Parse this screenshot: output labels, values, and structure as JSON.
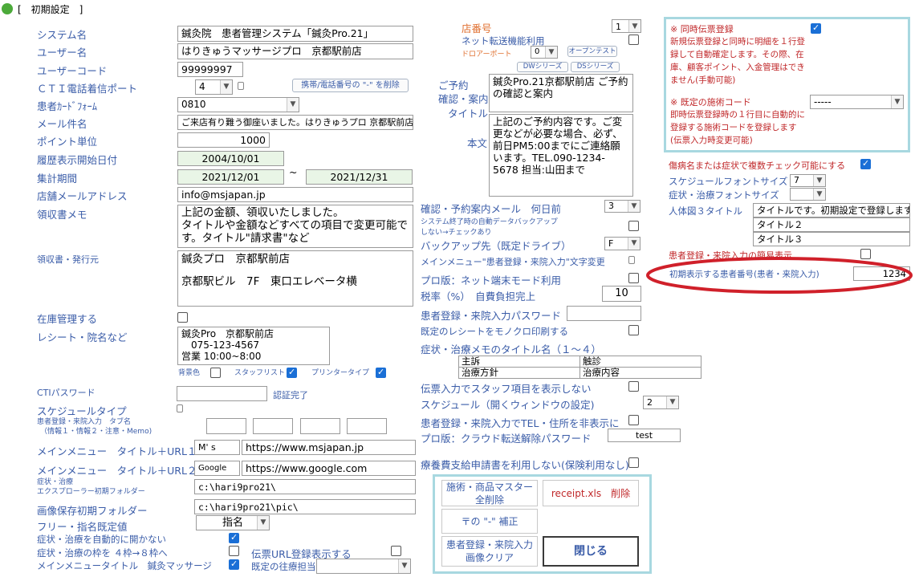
{
  "window": {
    "title": "[　初期設定　]",
    "bracket": "["
  },
  "left": {
    "system_name": {
      "label": "システム名",
      "value": "鍼灸院　患者管理システム「鍼灸Pro.21」"
    },
    "user_name": {
      "label": "ユーザー名",
      "value": "はりきゅうマッサージプロ　京都駅前店"
    },
    "user_code": {
      "label": "ユーザーコード",
      "value": "99999997"
    },
    "cti_port": {
      "label": "ＣＴＩ電話着信ポート",
      "value": "4",
      "btn": "携帯/電話番号の \"-\" を削除"
    },
    "card_form": {
      "label": "患者ｶｰﾄﾞﾌｫｰﾑ",
      "value": "0810"
    },
    "mail_subject": {
      "label": "メール件名",
      "value": "ご来店有り難う御座いました。はりきゅうプロ 京都駅前店"
    },
    "point_unit": {
      "label": "ポイント単位",
      "value": "1000"
    },
    "history_start": {
      "label": "履歴表示開始日付",
      "value": "2004/10/01"
    },
    "period": {
      "label": "集計期間",
      "from": "2021/12/01",
      "sep": "~",
      "to": "2021/12/31"
    },
    "shop_mail": {
      "label": "店舗メールアドレス",
      "value": "info@msjapan.jp"
    },
    "receipt_memo": {
      "label": "領収書メモ",
      "value": "上記の金額、領収いたしました。\nタイトルや金額などすべての項目で変更可能です。タイトル\"請求書\"など"
    },
    "receipt_issuer": {
      "label": "領収書・発行元",
      "line1": "鍼灸プロ　京都駅前店",
      "line2": "京都駅ビル　7F　東口エレベータ横"
    },
    "stock": {
      "label": "在庫管理する"
    },
    "receipt_name": {
      "label": "レシート・院名など",
      "line1": "鍼灸Pro　京都駅前店",
      "line2": "　075-123-4567",
      "line3": " 営業 10:00~8:00"
    },
    "bg_color": "背景色",
    "staff_list": "スタッフリスト",
    "printer_type": "プリンタータイプ",
    "cti_password": {
      "label": "CTIパスワード",
      "status": "認証完了"
    },
    "schedule_type": {
      "label": "スケジュールタイプ"
    },
    "tab_names": {
      "label1": "患者登録・来院入力　タブ名",
      "label2": "（情報１・情報２・注意・Memo)"
    },
    "menu1": {
      "label": "メインメニュー　タイトル＋URL１",
      "title": "M' s",
      "url": "https://www.msjapan.jp"
    },
    "menu2": {
      "label": "メインメニュー　タイトル＋URL２",
      "title": "Google",
      "url": "https://www.google.com"
    },
    "explorer": {
      "label1": "症状・治療",
      "label2": "エクスプローラー初期フォルダー",
      "value": "c:\\hari9pro21\\"
    },
    "image_folder": {
      "label": "画像保存初期フォルダー",
      "value": "c:\\hari9pro21\\pic\\"
    },
    "free_default": {
      "label": "フリー・指名既定値",
      "value": "指名"
    },
    "no_auto_open": {
      "label": "症状・治療を自動的に開かない"
    },
    "frame_4to8": {
      "label": "症状・治療の枠を ４枠→８枠へ"
    },
    "menu_title": {
      "label": "メインメニュータイトル　鍼灸マッサージ"
    },
    "slip_url": {
      "label": "伝票URL登録表示する"
    },
    "default_staff": {
      "label": "既定の往療担当"
    }
  },
  "middle": {
    "shop_no": {
      "label": "店番号",
      "value": "1"
    },
    "net_transfer": {
      "label": "ネット転送機能利用"
    },
    "dropper": {
      "label": "ドロアーポート",
      "value": "0",
      "btn": "オープンテスト"
    },
    "dw_btn": "DWシリーズ",
    "ds_btn": "DSシリーズ",
    "reservation_label1": "ご予約",
    "reservation_label2": "確認・案内",
    "reservation_label3": "タイトル",
    "reservation_title": "鍼灸Pro.21京都駅前店 ご予約の確認と案内",
    "body_label": "本文",
    "reservation_body": "上記のご予約内容です。ご変更などが必要な場合、必ず、前日PM5:00までにご連絡願います。TEL.090-1234-5678 担当:山田まで",
    "mail_days": {
      "label": "確認・予約案内メール　何日前",
      "value": "3"
    },
    "auto_backup": {
      "label1": "システム終了時の自動データバックアップ",
      "label2": "しない→チェックあり"
    },
    "backup_drive": {
      "label": "バックアップ先（既定ドライブ）",
      "value": "F"
    },
    "menu_text_change": {
      "label": "メインメニュー\"患者登録・来院入力\"文字変更"
    },
    "pro_net": {
      "label": "プロ版：ネット端末モード利用"
    },
    "tax": {
      "label": "税率（%）　自費負担完上",
      "value": "10"
    },
    "patient_pw": {
      "label": "患者登録・来院入力パスワード"
    },
    "mono_print": {
      "label": "既定のレシートをモノクロ印刷する"
    },
    "memo_titles": {
      "label": "症状・治療メモのタイトル名（１～４）",
      "t1": "主訴",
      "t2": "触診",
      "t3": "治療方針",
      "t4": "治療内容"
    },
    "hide_staff": {
      "label": "伝票入力でスタッフ項目を表示しない"
    },
    "schedule_window": {
      "label": "スケジュール（開くウィンドウの設定)",
      "value": "2"
    },
    "hide_tel": {
      "label": "患者登録・来院入力でTEL・住所を非表示に"
    },
    "cloud_pw": {
      "label": "プロ版：クラウド転送解除パスワード",
      "value": "test"
    },
    "insurance": {
      "label": "療養費支給申請書を利用しない(保険利用なし)"
    },
    "buttons": {
      "master_delete": "施術・商品マスター\n全削除",
      "receipt_delete": "receipt.xls　削除",
      "zip_fix": "〒の \"-\" 補正",
      "image_clear": "患者登録・来院入力\n画像クリア",
      "close": "閉じる"
    }
  },
  "right": {
    "simultaneous": {
      "label": "※ 同時伝票登録",
      "desc": "新規伝票登録と同時に明細を１行登録して自動確定します。その際、在庫、顧客ポイント、入金管理はできません(手動可能)"
    },
    "default_code": {
      "label": "※ 既定の施術コード",
      "value": "-----",
      "desc": "即時伝票登録時の１行目に自動的に登録する施術コードを登録します(伝票入力時変更可能)"
    },
    "multi_check": {
      "label": "傷病名または症状で複数チェック可能にする"
    },
    "schedule_font": {
      "label": "スケジュールフォントサイズ",
      "value": "7"
    },
    "symptom_font": {
      "label": "症状・治療フォントサイズ",
      "value": ""
    },
    "figure_title": {
      "label": "人体図３タイトル",
      "t1": "タイトルです。初期設定で登録します",
      "t2": "タイトル２",
      "t3": "タイトル３"
    },
    "simple_display": {
      "label": "患者登録・来院入力の簡易表示"
    },
    "initial_patient": {
      "label": "初期表示する患者番号(患者・来院入力)",
      "value": "1234"
    }
  },
  "colors": {
    "label_blue": "#3a5ca8",
    "accent_orange": "#e07030",
    "note_red": "#c0282a",
    "panel_border": "#a8d8e0",
    "highlight_ellipse": "#d0202a",
    "check_blue": "#1a6fd6"
  }
}
